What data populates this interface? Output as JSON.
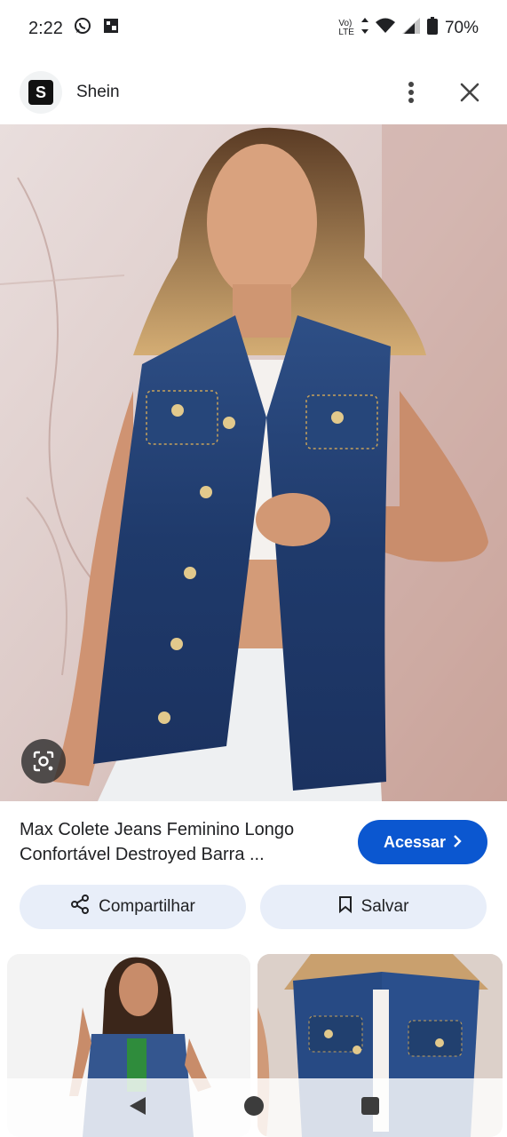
{
  "status_bar": {
    "time": "2:22",
    "network_top": "Vo)",
    "network_bottom": "LTE",
    "battery": "70%",
    "icons": [
      "whatsapp-icon",
      "photo-icon",
      "data-arrows-icon",
      "wifi-icon",
      "signal-icon",
      "battery-icon"
    ]
  },
  "header": {
    "logo_letter": "S",
    "site_name": "Shein",
    "icons": [
      "more-vert-icon",
      "close-icon"
    ]
  },
  "hero": {
    "icons": [
      "google-lens-icon"
    ]
  },
  "product": {
    "title": "Max Colete Jeans Feminino Longo Confortável Destroyed Barra ...",
    "visit_label": "Acessar",
    "visit_icon": "chevron-right-icon",
    "accent_color": "#0b57d0"
  },
  "actions": {
    "share_label": "Compartilhar",
    "share_icon": "share-icon",
    "save_label": "Salvar",
    "save_icon": "bookmark-icon",
    "button_bg": "#e8eef9"
  },
  "navbar": {
    "icons": [
      "back-icon",
      "home-icon",
      "recents-icon"
    ]
  }
}
